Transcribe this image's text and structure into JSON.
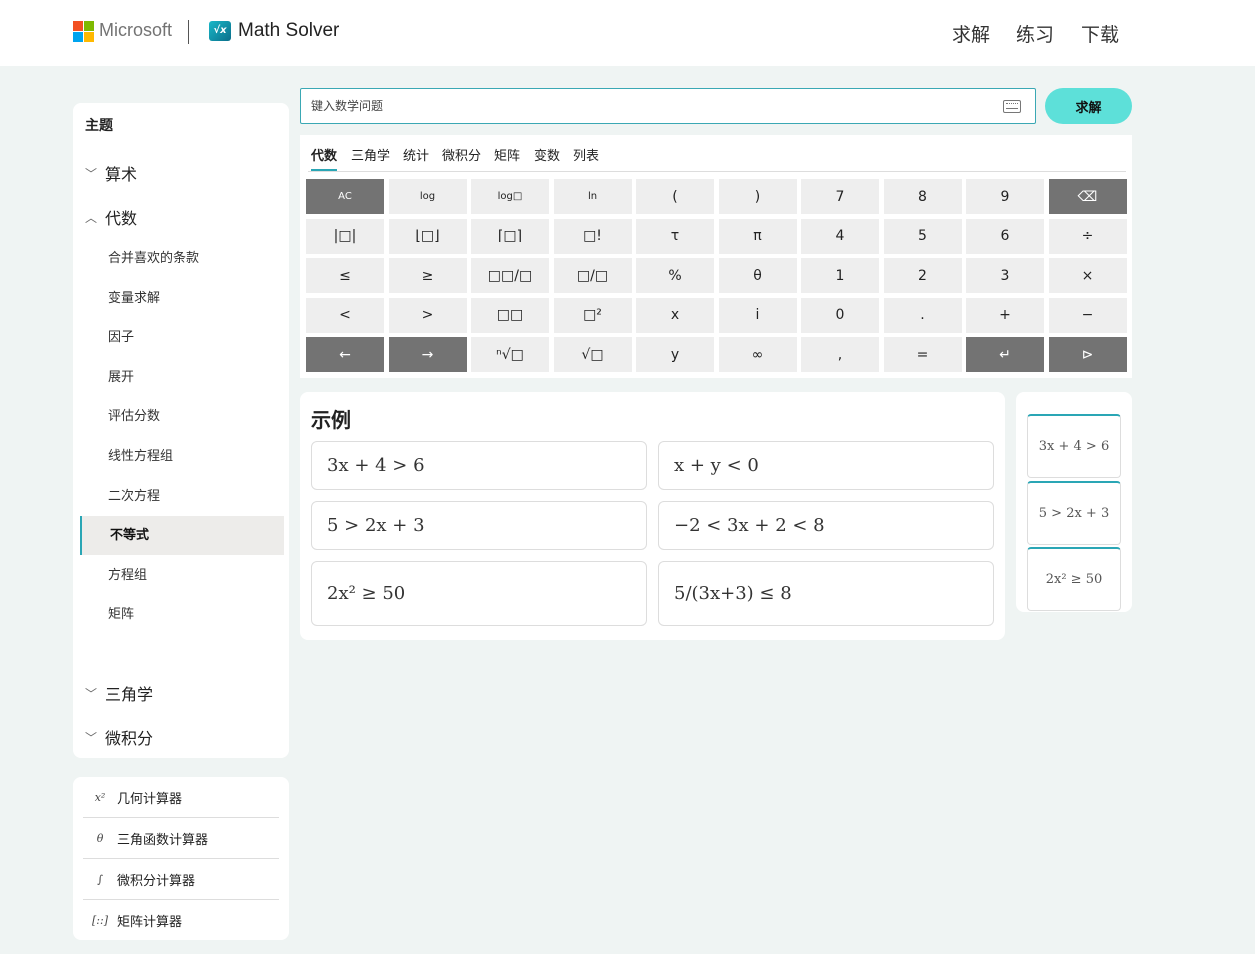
{
  "header": {
    "brand": "Microsoft",
    "app_icon_text": "√x",
    "app_name": "Math Solver",
    "logo_colors": [
      "#f25022",
      "#7fba00",
      "#00a4ef",
      "#ffb900"
    ],
    "nav": [
      "求解",
      "练习",
      "下载"
    ]
  },
  "sidebar": {
    "title": "主题",
    "groups": [
      {
        "label": "算术",
        "expanded": false
      },
      {
        "label": "代数",
        "expanded": true
      },
      {
        "label": "三角学",
        "expanded": false
      },
      {
        "label": "微积分",
        "expanded": false
      }
    ],
    "items": [
      "合并喜欢的条款",
      "变量求解",
      "因子",
      "展开",
      "评估分数",
      "线性方程组",
      "二次方程",
      "不等式",
      "方程组",
      "矩阵"
    ],
    "active_item": "不等式"
  },
  "tools": [
    {
      "icon": "x²",
      "label": "几何计算器"
    },
    {
      "icon": "θ",
      "label": "三角函数计算器"
    },
    {
      "icon": "∫",
      "label": "微积分计算器"
    },
    {
      "icon": "[::]",
      "label": "矩阵计算器"
    }
  ],
  "search": {
    "placeholder": "键入数学问题",
    "value": "",
    "solve_label": "求解"
  },
  "keypad": {
    "tabs": [
      "代数",
      "三角学",
      "统计",
      "微积分",
      "矩阵",
      "变数",
      "列表"
    ],
    "active_tab": "代数",
    "rows": [
      [
        "AC",
        "log",
        "log□",
        "ln",
        "(",
        ")",
        "7",
        "8",
        "9",
        "⌫"
      ],
      [
        "|□|",
        "⌊□⌋",
        "⌈□⌉",
        "□!",
        "τ",
        "π",
        "4",
        "5",
        "6",
        "÷"
      ],
      [
        "≤",
        "≥",
        "□□/□",
        "□/□",
        "%",
        "θ",
        "1",
        "2",
        "3",
        "×"
      ],
      [
        "<",
        ">",
        "□□",
        "□²",
        "x",
        "i",
        "0",
        ".",
        "+",
        "−"
      ],
      [
        "←",
        "→",
        "ⁿ√□",
        "√□",
        "y",
        "∞",
        ",",
        "=",
        "↵",
        "⊳"
      ]
    ]
  },
  "examples": {
    "title": "示例",
    "items": [
      "3x + 4 > 6",
      "x + y < 0",
      "5 > 2x + 3",
      "−2 < 3x + 2 < 8",
      "2x² ≥ 50",
      "5/(3x+3) ≤ 8"
    ],
    "mini": [
      "3x + 4 > 6",
      "5 > 2x + 3",
      "2x² ≥ 50"
    ]
  }
}
